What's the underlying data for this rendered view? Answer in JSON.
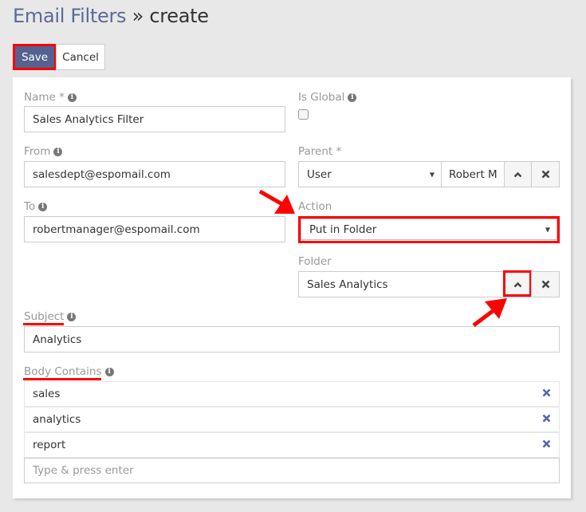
{
  "header": {
    "breadcrumb_parent": "Email Filters",
    "separator": "»",
    "current": "create"
  },
  "toolbar": {
    "save_label": "Save",
    "cancel_label": "Cancel"
  },
  "form": {
    "name": {
      "label": "Name *",
      "value": "Sales Analytics Filter"
    },
    "is_global": {
      "label": "Is Global",
      "checked": false
    },
    "from": {
      "label": "From",
      "value": "salesdept@espomail.com"
    },
    "parent": {
      "label": "Parent *",
      "type_value": "User",
      "record_value": "Robert M"
    },
    "to": {
      "label": "To",
      "value": "robertmanager@espomail.com"
    },
    "action": {
      "label": "Action",
      "value": "Put in Folder"
    },
    "folder": {
      "label": "Folder",
      "value": "Sales Analytics"
    },
    "subject": {
      "label": "Subject",
      "value": "Analytics"
    },
    "body_contains": {
      "label": "Body Contains",
      "items": [
        "sales",
        "analytics",
        "report"
      ],
      "placeholder": "Type & press enter"
    }
  },
  "icons": {
    "info": "i",
    "remove": "✕",
    "caret": "▼"
  },
  "colors": {
    "accent": "#55628f",
    "highlight": "#ff0000",
    "remove_icon": "#4d6aa3"
  }
}
